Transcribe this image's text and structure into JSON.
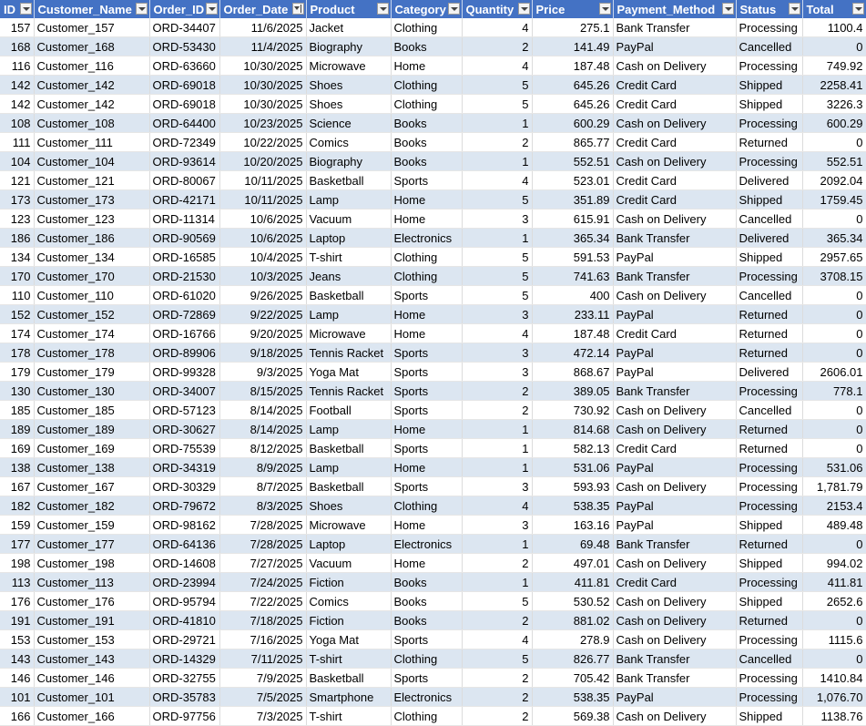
{
  "headers": [
    "ID",
    "Customer_Name",
    "Order_ID",
    "Order_Date",
    "Product",
    "Category",
    "Quantity",
    "Price",
    "Payment_Method",
    "Status",
    "Total"
  ],
  "rows": [
    [
      "157",
      "Customer_157",
      "ORD-34407",
      "11/6/2025",
      "Jacket",
      "Clothing",
      "4",
      "275.1",
      "Bank Transfer",
      "Processing",
      "1100.4"
    ],
    [
      "168",
      "Customer_168",
      "ORD-53430",
      "11/4/2025",
      "Biography",
      "Books",
      "2",
      "141.49",
      "PayPal",
      "Cancelled",
      "0"
    ],
    [
      "116",
      "Customer_116",
      "ORD-63660",
      "10/30/2025",
      "Microwave",
      "Home",
      "4",
      "187.48",
      "Cash on Delivery",
      "Processing",
      "749.92"
    ],
    [
      "142",
      "Customer_142",
      "ORD-69018",
      "10/30/2025",
      "Shoes",
      "Clothing",
      "5",
      "645.26",
      "Credit Card",
      "Shipped",
      "2258.41"
    ],
    [
      "142",
      "Customer_142",
      "ORD-69018",
      "10/30/2025",
      "Shoes",
      "Clothing",
      "5",
      "645.26",
      "Credit Card",
      "Shipped",
      "3226.3"
    ],
    [
      "108",
      "Customer_108",
      "ORD-64400",
      "10/23/2025",
      "Science",
      "Books",
      "1",
      "600.29",
      "Cash on Delivery",
      "Processing",
      "600.29"
    ],
    [
      "111",
      "Customer_111",
      "ORD-72349",
      "10/22/2025",
      "Comics",
      "Books",
      "2",
      "865.77",
      "Credit Card",
      "Returned",
      "0"
    ],
    [
      "104",
      "Customer_104",
      "ORD-93614",
      "10/20/2025",
      "Biography",
      "Books",
      "1",
      "552.51",
      "Cash on Delivery",
      "Processing",
      "552.51"
    ],
    [
      "121",
      "Customer_121",
      "ORD-80067",
      "10/11/2025",
      "Basketball",
      "Sports",
      "4",
      "523.01",
      "Credit Card",
      "Delivered",
      "2092.04"
    ],
    [
      "173",
      "Customer_173",
      "ORD-42171",
      "10/11/2025",
      "Lamp",
      "Home",
      "5",
      "351.89",
      "Credit Card",
      "Shipped",
      "1759.45"
    ],
    [
      "123",
      "Customer_123",
      "ORD-11314",
      "10/6/2025",
      "Vacuum",
      "Home",
      "3",
      "615.91",
      "Cash on Delivery",
      "Cancelled",
      "0"
    ],
    [
      "186",
      "Customer_186",
      "ORD-90569",
      "10/6/2025",
      "Laptop",
      "Electronics",
      "1",
      "365.34",
      "Bank Transfer",
      "Delivered",
      "365.34"
    ],
    [
      "134",
      "Customer_134",
      "ORD-16585",
      "10/4/2025",
      "T-shirt",
      "Clothing",
      "5",
      "591.53",
      "PayPal",
      "Shipped",
      "2957.65"
    ],
    [
      "170",
      "Customer_170",
      "ORD-21530",
      "10/3/2025",
      "Jeans",
      "Clothing",
      "5",
      "741.63",
      "Bank Transfer",
      "Processing",
      "3708.15"
    ],
    [
      "110",
      "Customer_110",
      "ORD-61020",
      "9/26/2025",
      "Basketball",
      "Sports",
      "5",
      "400",
      "Cash on Delivery",
      "Cancelled",
      "0"
    ],
    [
      "152",
      "Customer_152",
      "ORD-72869",
      "9/22/2025",
      "Lamp",
      "Home",
      "3",
      "233.11",
      "PayPal",
      "Returned",
      "0"
    ],
    [
      "174",
      "Customer_174",
      "ORD-16766",
      "9/20/2025",
      "Microwave",
      "Home",
      "4",
      "187.48",
      "Credit Card",
      "Returned",
      "0"
    ],
    [
      "178",
      "Customer_178",
      "ORD-89906",
      "9/18/2025",
      "Tennis Racket",
      "Sports",
      "3",
      "472.14",
      "PayPal",
      "Returned",
      "0"
    ],
    [
      "179",
      "Customer_179",
      "ORD-99328",
      "9/3/2025",
      "Yoga Mat",
      "Sports",
      "3",
      "868.67",
      "PayPal",
      "Delivered",
      "2606.01"
    ],
    [
      "130",
      "Customer_130",
      "ORD-34007",
      "8/15/2025",
      "Tennis Racket",
      "Sports",
      "2",
      "389.05",
      "Bank Transfer",
      "Processing",
      "778.1"
    ],
    [
      "185",
      "Customer_185",
      "ORD-57123",
      "8/14/2025",
      "Football",
      "Sports",
      "2",
      "730.92",
      "Cash on Delivery",
      "Cancelled",
      "0"
    ],
    [
      "189",
      "Customer_189",
      "ORD-30627",
      "8/14/2025",
      "Lamp",
      "Home",
      "1",
      "814.68",
      "Cash on Delivery",
      "Returned",
      "0"
    ],
    [
      "169",
      "Customer_169",
      "ORD-75539",
      "8/12/2025",
      "Basketball",
      "Sports",
      "1",
      "582.13",
      "Credit Card",
      "Returned",
      "0"
    ],
    [
      "138",
      "Customer_138",
      "ORD-34319",
      "8/9/2025",
      "Lamp",
      "Home",
      "1",
      "531.06",
      "PayPal",
      "Processing",
      "531.06"
    ],
    [
      "167",
      "Customer_167",
      "ORD-30329",
      "8/7/2025",
      "Basketball",
      "Sports",
      "3",
      "593.93",
      "Cash on Delivery",
      "Processing",
      "1,781.79"
    ],
    [
      "182",
      "Customer_182",
      "ORD-79672",
      "8/3/2025",
      "Shoes",
      "Clothing",
      "4",
      "538.35",
      "PayPal",
      "Processing",
      "2153.4"
    ],
    [
      "159",
      "Customer_159",
      "ORD-98162",
      "7/28/2025",
      "Microwave",
      "Home",
      "3",
      "163.16",
      "PayPal",
      "Shipped",
      "489.48"
    ],
    [
      "177",
      "Customer_177",
      "ORD-64136",
      "7/28/2025",
      "Laptop",
      "Electronics",
      "1",
      "69.48",
      "Bank Transfer",
      "Returned",
      "0"
    ],
    [
      "198",
      "Customer_198",
      "ORD-14608",
      "7/27/2025",
      "Vacuum",
      "Home",
      "2",
      "497.01",
      "Cash on Delivery",
      "Shipped",
      "994.02"
    ],
    [
      "113",
      "Customer_113",
      "ORD-23994",
      "7/24/2025",
      "Fiction",
      "Books",
      "1",
      "411.81",
      "Credit Card",
      "Processing",
      "411.81"
    ],
    [
      "176",
      "Customer_176",
      "ORD-95794",
      "7/22/2025",
      "Comics",
      "Books",
      "5",
      "530.52",
      "Cash on Delivery",
      "Shipped",
      "2652.6"
    ],
    [
      "191",
      "Customer_191",
      "ORD-41810",
      "7/18/2025",
      "Fiction",
      "Books",
      "2",
      "881.02",
      "Cash on Delivery",
      "Returned",
      "0"
    ],
    [
      "153",
      "Customer_153",
      "ORD-29721",
      "7/16/2025",
      "Yoga Mat",
      "Sports",
      "4",
      "278.9",
      "Cash on Delivery",
      "Processing",
      "1115.6"
    ],
    [
      "143",
      "Customer_143",
      "ORD-14329",
      "7/11/2025",
      "T-shirt",
      "Clothing",
      "5",
      "826.77",
      "Bank Transfer",
      "Cancelled",
      "0"
    ],
    [
      "146",
      "Customer_146",
      "ORD-32755",
      "7/9/2025",
      "Basketball",
      "Sports",
      "2",
      "705.42",
      "Bank Transfer",
      "Processing",
      "1410.84"
    ],
    [
      "101",
      "Customer_101",
      "ORD-35783",
      "7/5/2025",
      "Smartphone",
      "Electronics",
      "2",
      "538.35",
      "PayPal",
      "Processing",
      "1,076.70"
    ],
    [
      "166",
      "Customer_166",
      "ORD-97756",
      "7/3/2025",
      "T-shirt",
      "Clothing",
      "2",
      "569.38",
      "Cash on Delivery",
      "Shipped",
      "1138.76"
    ]
  ]
}
